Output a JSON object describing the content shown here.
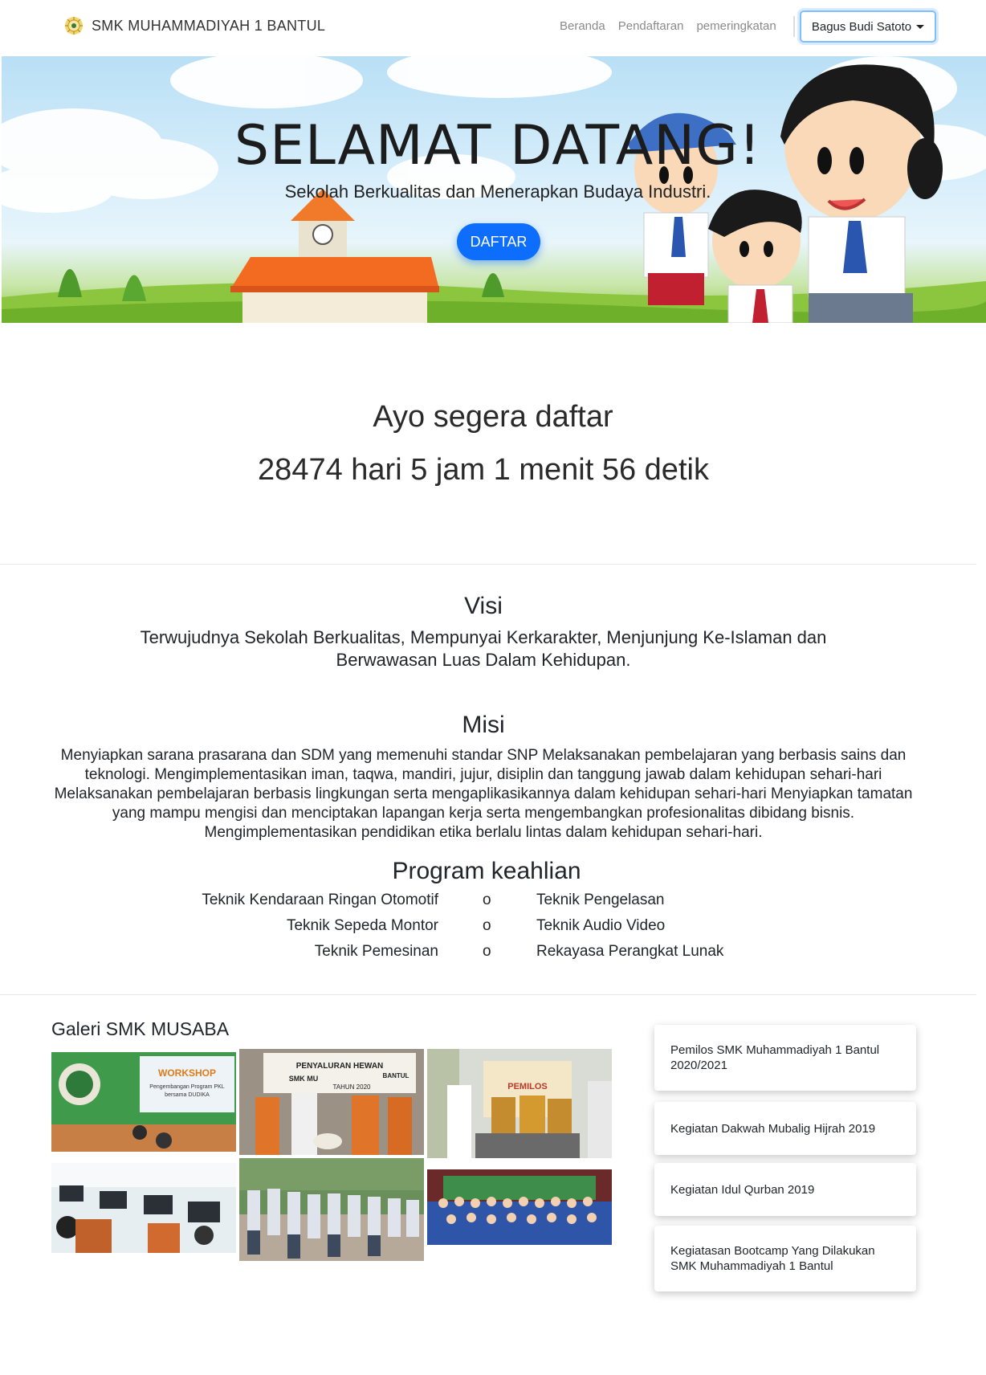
{
  "navbar": {
    "brand": "SMK MUHAMMADIYAH 1 BANTUL",
    "links": [
      "Beranda",
      "Pendaftaran",
      "pemeringkatan"
    ],
    "user": "Bagus Budi Satoto"
  },
  "hero": {
    "title": "SELAMAT DATANG!",
    "subtitle": "Sekolah Berkualitas dan Menerapkan Budaya Industri.",
    "button": "DAFTAR"
  },
  "countdown": {
    "title": "Ayo segera daftar",
    "value": "28474 hari 5 jam 1 menit 56 detik"
  },
  "visi": {
    "heading": "Visi",
    "text": "Terwujudnya Sekolah Berkualitas, Mempunyai Kerkarakter, Menjunjung Ke-Islaman dan Berwawasan Luas Dalam Kehidupan."
  },
  "misi": {
    "heading": "Misi",
    "text": "Menyiapkan sarana prasarana dan SDM yang memenuhi standar SNP Melaksanakan pembelajaran yang berbasis sains dan teknologi. Mengimplementasikan iman, taqwa, mandiri, jujur, disiplin dan tanggung jawab dalam kehidupan sehari-hari Melaksanakan pembelajaran berbasis lingkungan serta mengaplikasikannya dalam kehidupan sehari-hari Menyiapkan tamatan yang mampu mengisi dan menciptakan lapangan kerja serta mengembangkan profesionalitas dibidang bisnis. Mengimplementasikan pendidikan etika berlalu lintas dalam kehidupan sehari-hari."
  },
  "program": {
    "heading": "Program keahlian",
    "bullet": "o",
    "rows": [
      {
        "left": "Teknik Kendaraan Ringan Otomotif",
        "right": "Teknik Pengelasan"
      },
      {
        "left": "Teknik Sepeda Montor",
        "right": "Teknik Audio Video"
      },
      {
        "left": "Teknik Pemesinan",
        "right": "Rekayasa Perangkat Lunak"
      }
    ]
  },
  "gallery": {
    "title": "Galeri SMK MUSABA",
    "photos": [
      "workshop-photo",
      "distribution-photo",
      "ceremony-photo",
      "computer-lab-photo",
      "students-line-photo",
      "group-photo"
    ],
    "photo_texts": {
      "workshop_banner": "WORKSHOP",
      "workshop_sub1": "Pengembangan Program PKL",
      "workshop_sub2": "bersama DUDIKA",
      "distribution_banner": "PENYALURAN HEWAN",
      "distribution_sub1": "SMK MU",
      "distribution_sub2": "BANTUL",
      "distribution_sub3": "TAHUN 2020",
      "ceremony_banner": "PEMILOS"
    }
  },
  "news": [
    "Pemilos SMK Muhammadiyah 1 Bantul 2020/2021",
    "Kegiatan Dakwah Mubalig Hijrah 2019",
    "Kegiatan Idul Qurban 2019",
    "Kegiatasan Bootcamp Yang Dilakukan SMK Muhammadiyah 1 Bantul"
  ],
  "colors": {
    "primary": "#0d6efd",
    "nav_link": "#8a8a8a",
    "focus_ring": "#80bdff"
  }
}
